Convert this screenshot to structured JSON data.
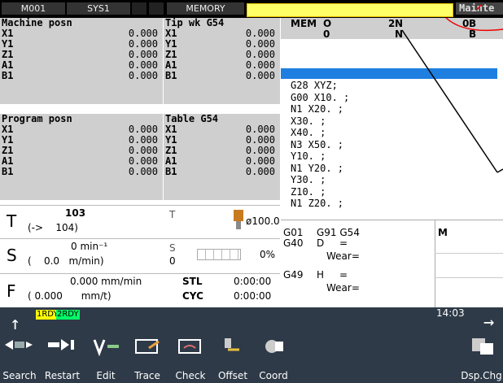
{
  "topbar": {
    "machine": "M001",
    "system": "SYS1",
    "mode": "MEMORY",
    "alarm_text": "",
    "mainte_label": "Mainte"
  },
  "machine_posn": {
    "title": "Machine posn",
    "rows": [
      {
        "axis": "X1",
        "value": "0.000"
      },
      {
        "axis": "Y1",
        "value": "0.000"
      },
      {
        "axis": "Z1",
        "value": "0.000"
      },
      {
        "axis": "A1",
        "value": "0.000"
      },
      {
        "axis": "B1",
        "value": "0.000"
      }
    ]
  },
  "tip_wk": {
    "title": "Tip wk G54",
    "rows": [
      {
        "axis": "X1",
        "value": "0.000"
      },
      {
        "axis": "Y1",
        "value": "0.000"
      },
      {
        "axis": "Z1",
        "value": "0.000"
      },
      {
        "axis": "A1",
        "value": "0.000"
      },
      {
        "axis": "B1",
        "value": "0.000"
      }
    ]
  },
  "program_posn": {
    "title": "Program posn",
    "rows": [
      {
        "axis": "X1",
        "value": "0.000"
      },
      {
        "axis": "Y1",
        "value": "0.000"
      },
      {
        "axis": "Z1",
        "value": "0.000"
      },
      {
        "axis": "A1",
        "value": "0.000"
      },
      {
        "axis": "B1",
        "value": "0.000"
      }
    ]
  },
  "table": {
    "title": "Table  G54",
    "rows": [
      {
        "axis": "X1",
        "value": "0.000"
      },
      {
        "axis": "Y1",
        "value": "0.000"
      },
      {
        "axis": "Z1",
        "value": "0.000"
      },
      {
        "axis": "A1",
        "value": "0.000"
      },
      {
        "axis": "B1",
        "value": "0.000"
      }
    ]
  },
  "tool": {
    "letter": "T",
    "number": "103",
    "sub": "(->    104)",
    "t_label": "T",
    "diameter": "ø100.0"
  },
  "spindle": {
    "letter": "S",
    "speed": "0 min⁻¹",
    "sub": "(    0.0   m/min)",
    "s_label": "S",
    "s_value": "0",
    "percent": "0%"
  },
  "feed": {
    "letter": "F",
    "value": "0.000 mm/min",
    "sub": "( 0.000      mm/t)",
    "stl_label": "STL",
    "stl_time": "0:00:00",
    "cyc_label": "CYC",
    "cyc_time": "0:00:00"
  },
  "program": {
    "mem": "MEM",
    "o_label": "O",
    "o_value": "0",
    "n_label": "N",
    "n_value": "2",
    "b_label": "B",
    "b_value": "0",
    "lines": [
      "G28 XYZ;",
      "G00 X10. ;",
      "N1 X20. ;",
      "X30. ;",
      "X40. ;",
      "N3 X50. ;",
      "Y10. ;",
      "N1 Y20. ;",
      "Y30. ;",
      "Z10. ;",
      "N1 Z20. ;"
    ]
  },
  "modal": {
    "g1": "G01",
    "g2": "G91 G54",
    "g3": "G40",
    "d_label": "D",
    "d_eq": "=",
    "wear1": "Wear=",
    "g4": "G49",
    "h_label": "H",
    "h_eq": "=",
    "wear2": "Wear=",
    "m_label": "M"
  },
  "status": {
    "rdy1": "1RDY",
    "rdy2": "2RDY",
    "time": "14:03"
  },
  "softkeys": [
    "Search",
    "Restart",
    "Edit",
    "Trace",
    "Check",
    "Offset",
    "Coord",
    "Dsp.Chg"
  ],
  "colors": {
    "alarm": "#ffff66",
    "softbar": "#2e3a48",
    "badge1": "#ffff00",
    "badge2": "#00ff66",
    "cursor": "#1e7fe0"
  }
}
